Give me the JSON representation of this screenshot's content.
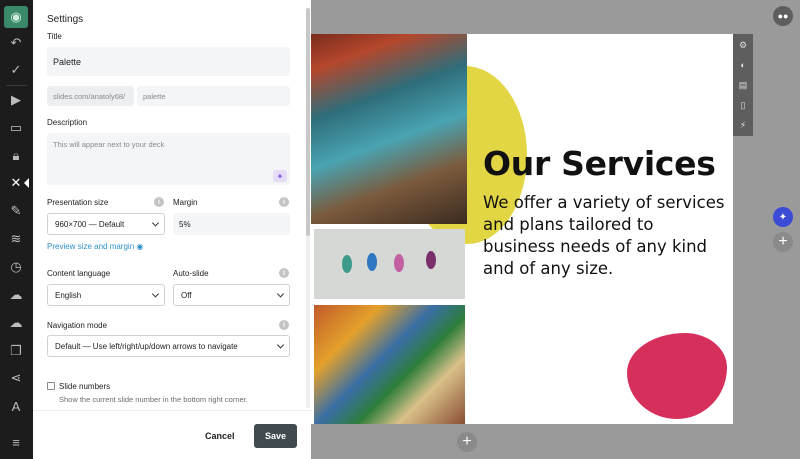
{
  "panel": {
    "title": "Settings",
    "title_label": "Title",
    "title_value": "Palette",
    "url_prefix": "slides.com/anatoly68/",
    "url_slug": "palette",
    "description_label": "Description",
    "description_placeholder": "This will appear next to your deck",
    "presentation_size_label": "Presentation size",
    "presentation_size_value": "960×700 — Default",
    "margin_label": "Margin",
    "margin_value": "5%",
    "preview_link": "Preview size and margin",
    "content_language_label": "Content language",
    "content_language_value": "English",
    "auto_slide_label": "Auto-slide",
    "auto_slide_value": "Off",
    "navigation_mode_label": "Navigation mode",
    "navigation_mode_value": "Default — Use left/right/up/down arrows to navigate",
    "slide_numbers_label": "Slide numbers",
    "slide_numbers_hint": "Show the current slide number in the bottom right corner.",
    "cancel_label": "Cancel",
    "save_label": "Save"
  },
  "slide": {
    "heading": "Our Services",
    "body": "We offer a variety of services and plans tailored to business needs of any kind and of any size."
  },
  "icons": {
    "leftbar": [
      "eye-icon",
      "undo-icon",
      "check-icon",
      "play-icon",
      "present-icon",
      "lock-icon",
      "close-icon",
      "brush-icon",
      "layers-icon",
      "history-icon",
      "cloud-upload-icon",
      "cloud-download-icon",
      "copy-icon",
      "share-icon",
      "translate-icon",
      "menu-icon"
    ],
    "rstrip": [
      "gear-icon",
      "toggle-icon",
      "keyboard-icon",
      "book-icon",
      "bolt-icon"
    ]
  },
  "colors": {
    "accent_yellow": "#e0d43a",
    "accent_pink": "#d72f5b",
    "link": "#2f8fc9",
    "save_bg": "#3f4b4f",
    "leftbar_bg": "#1c1c1c"
  }
}
